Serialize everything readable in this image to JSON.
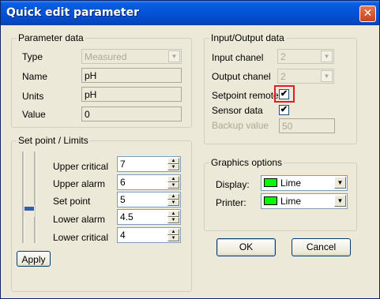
{
  "window": {
    "title": "Quick edit parameter",
    "close_glyph": "✕"
  },
  "parameter_data": {
    "legend": "Parameter data",
    "type_label": "Type",
    "type_value": "Measured",
    "name_label": "Name",
    "name_value": "pH",
    "units_label": "Units",
    "units_value": "pH",
    "value_label": "Value",
    "value_value": "0"
  },
  "io_data": {
    "legend": "Input/Output data",
    "input_label": "Input chanel",
    "input_value": "2",
    "output_label": "Output chanel",
    "output_value": "2",
    "setpoint_remote_label": "Setpoint remote",
    "setpoint_remote_checked": true,
    "sensor_data_label": "Sensor data",
    "sensor_data_checked": true,
    "backup_label": "Backup value",
    "backup_value": "50",
    "check_glyph": "✔"
  },
  "setpoint_limits": {
    "legend": "Set point / Limits",
    "rows": [
      {
        "label": "Upper critical",
        "value": "7"
      },
      {
        "label": "Upper alarm",
        "value": "6"
      },
      {
        "label": "Set point",
        "value": "5"
      },
      {
        "label": "Lower alarm",
        "value": "4.5"
      },
      {
        "label": "Lower critical",
        "value": "4"
      }
    ],
    "apply_label": "Apply",
    "spin_up": "▲",
    "spin_down": "▼"
  },
  "graphics_options": {
    "legend": "Graphics options",
    "display_label": "Display:",
    "display_value": "Lime",
    "printer_label": "Printer:",
    "printer_value": "Lime",
    "swatch_color": "#00ff00"
  },
  "buttons": {
    "ok": "OK",
    "cancel": "Cancel"
  },
  "combo_arrow": "▼"
}
